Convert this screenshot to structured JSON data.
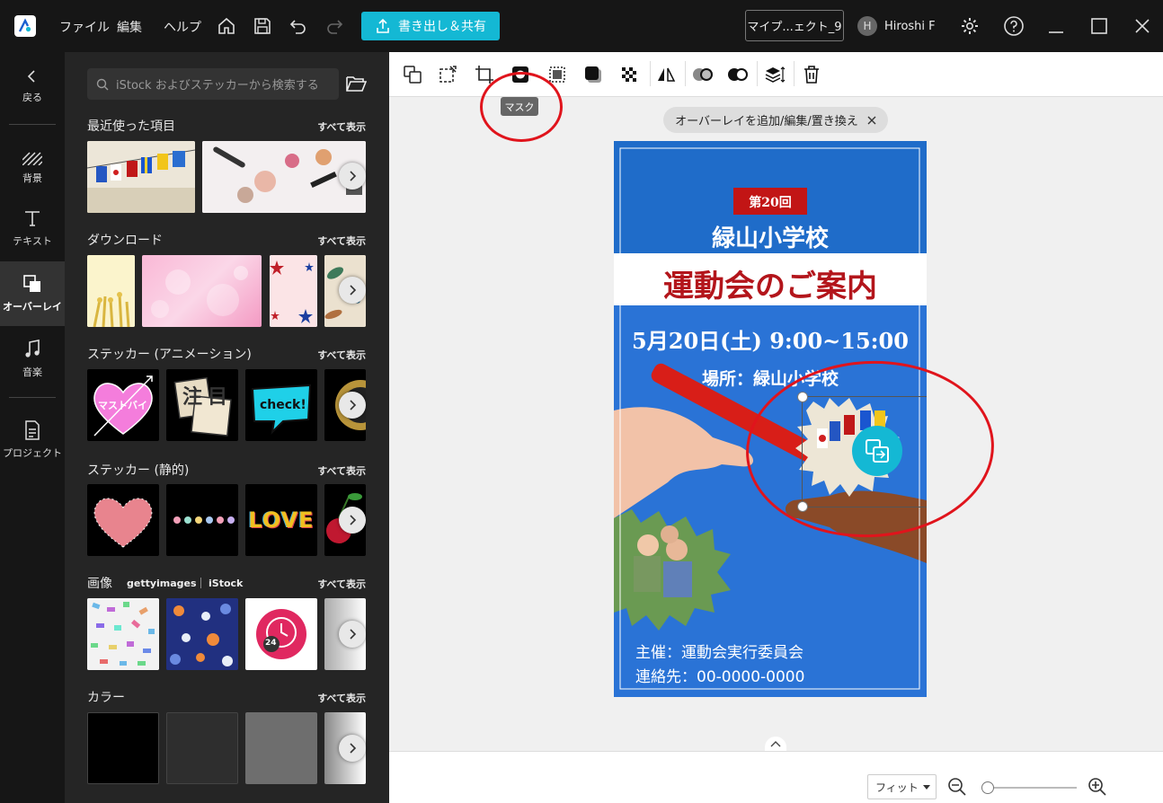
{
  "topbar": {
    "menu": [
      "ファイル",
      "編集",
      "ヘルプ"
    ],
    "export_label": "書き出し＆共有",
    "project_name": "マイプ...ェクト_9",
    "user_initial": "H",
    "user_name": "Hiroshi F"
  },
  "nav": {
    "back": "戻る",
    "items": [
      "背景",
      "テキスト",
      "オーバーレイ",
      "音楽",
      "プロジェクト"
    ],
    "active": "オーバーレイ"
  },
  "panel": {
    "search_placeholder": "iStock およびステッカーから検索する",
    "see_all": "すべて表示",
    "sections": [
      "最近使った項目",
      "ダウンロード",
      "ステッカー (アニメーション)",
      "ステッカー (静的)",
      "画像",
      "カラー"
    ],
    "image_providers": [
      "gettyimages",
      "iStock"
    ],
    "sticker_texts": [
      "マストバイ",
      "注目",
      "check!",
      "LOVE"
    ],
    "clock_badge": "24"
  },
  "toolbar": {
    "tooltip": "マスク",
    "overlay_chip": "オーバーレイを追加/編集/置き換え"
  },
  "poster": {
    "badge": "第20回",
    "school": "緑山小学校",
    "headline": "運動会のご案内",
    "datetime": "5月20日(土) 9:00~15:00",
    "place": "場所：緑山小学校",
    "organizer": "主催：運動会実行委員会",
    "contact": "連絡先：00-0000-0000"
  },
  "bottombar": {
    "fit_label": "フィット"
  },
  "colors": {
    "accent": "#14b8d4",
    "poster_blue": "#2a6ed0",
    "headline_red": "#b3151b",
    "annotation_red": "#e0141c"
  }
}
